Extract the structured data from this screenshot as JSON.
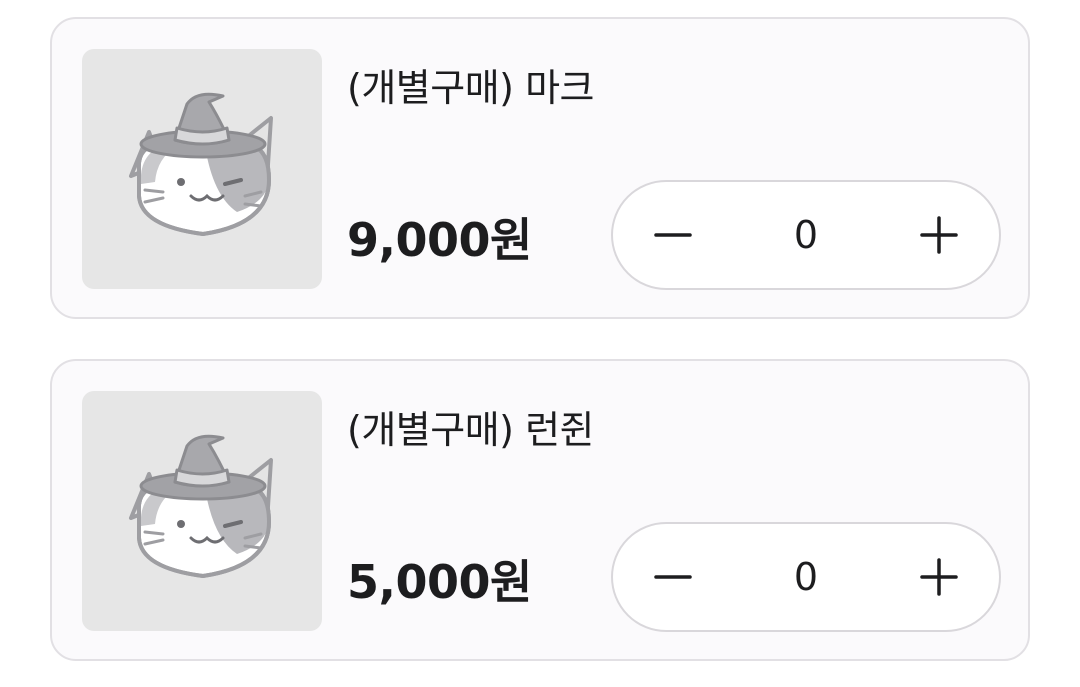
{
  "products": [
    {
      "title": "(개별구매) 마크",
      "price": "9,000원",
      "quantity": "0",
      "image_icon": "witch-hat-cat-placeholder"
    },
    {
      "title": "(개별구매) 런쥔",
      "price": "5,000원",
      "quantity": "0",
      "image_icon": "witch-hat-cat-placeholder"
    }
  ],
  "stepper": {
    "minus_icon": "minus-icon",
    "plus_icon": "plus-icon"
  },
  "colors": {
    "card_background": "#fbfafc",
    "card_border": "#e2e0e4",
    "thumbnail_background": "#e6e6e6",
    "text": "#1d1d1f",
    "stepper_border": "#d9d7db"
  }
}
